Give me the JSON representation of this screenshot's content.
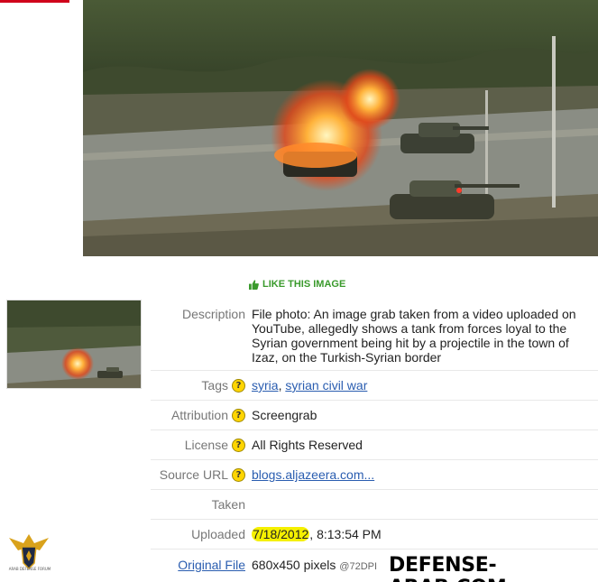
{
  "like_label": "LIKE THIS IMAGE",
  "details": {
    "description_label": "Description",
    "description": "File photo: An image grab taken from a video uploaded on YouTube, allegedly shows a tank from forces loyal to the Syrian government being hit by a projectile in the town of Izaz, on the Turkish-Syrian border",
    "tags_label": "Tags",
    "tags": [
      "syria",
      "syrian civil war"
    ],
    "tags_separator": ", ",
    "attribution_label": "Attribution",
    "attribution": "Screengrab",
    "license_label": "License",
    "license": "All Rights Reserved",
    "source_label": "Source URL",
    "source": "blogs.aljazeera.com...",
    "taken_label": "Taken",
    "taken": "",
    "uploaded_label": "Uploaded",
    "uploaded_date": "7/18/2012",
    "uploaded_time": ", 8:13:54 PM",
    "original_label": "Original File",
    "original_size": "680x450 pixels",
    "original_dpi": "@72DPI"
  },
  "help_glyph": "?",
  "watermark": "DEFENSE-ARAB.COM",
  "logo_text": "ARAB DEFENSE FORUM",
  "colors": {
    "accent_red": "#d0021b",
    "link": "#2a5db0",
    "like_green": "#3a9a2c",
    "highlight": "#f5f000",
    "help_badge": "#ffd500"
  },
  "icons": {
    "like": "thumbs-up-icon",
    "help": "question-mark-icon",
    "logo": "eagle-emblem-icon"
  }
}
